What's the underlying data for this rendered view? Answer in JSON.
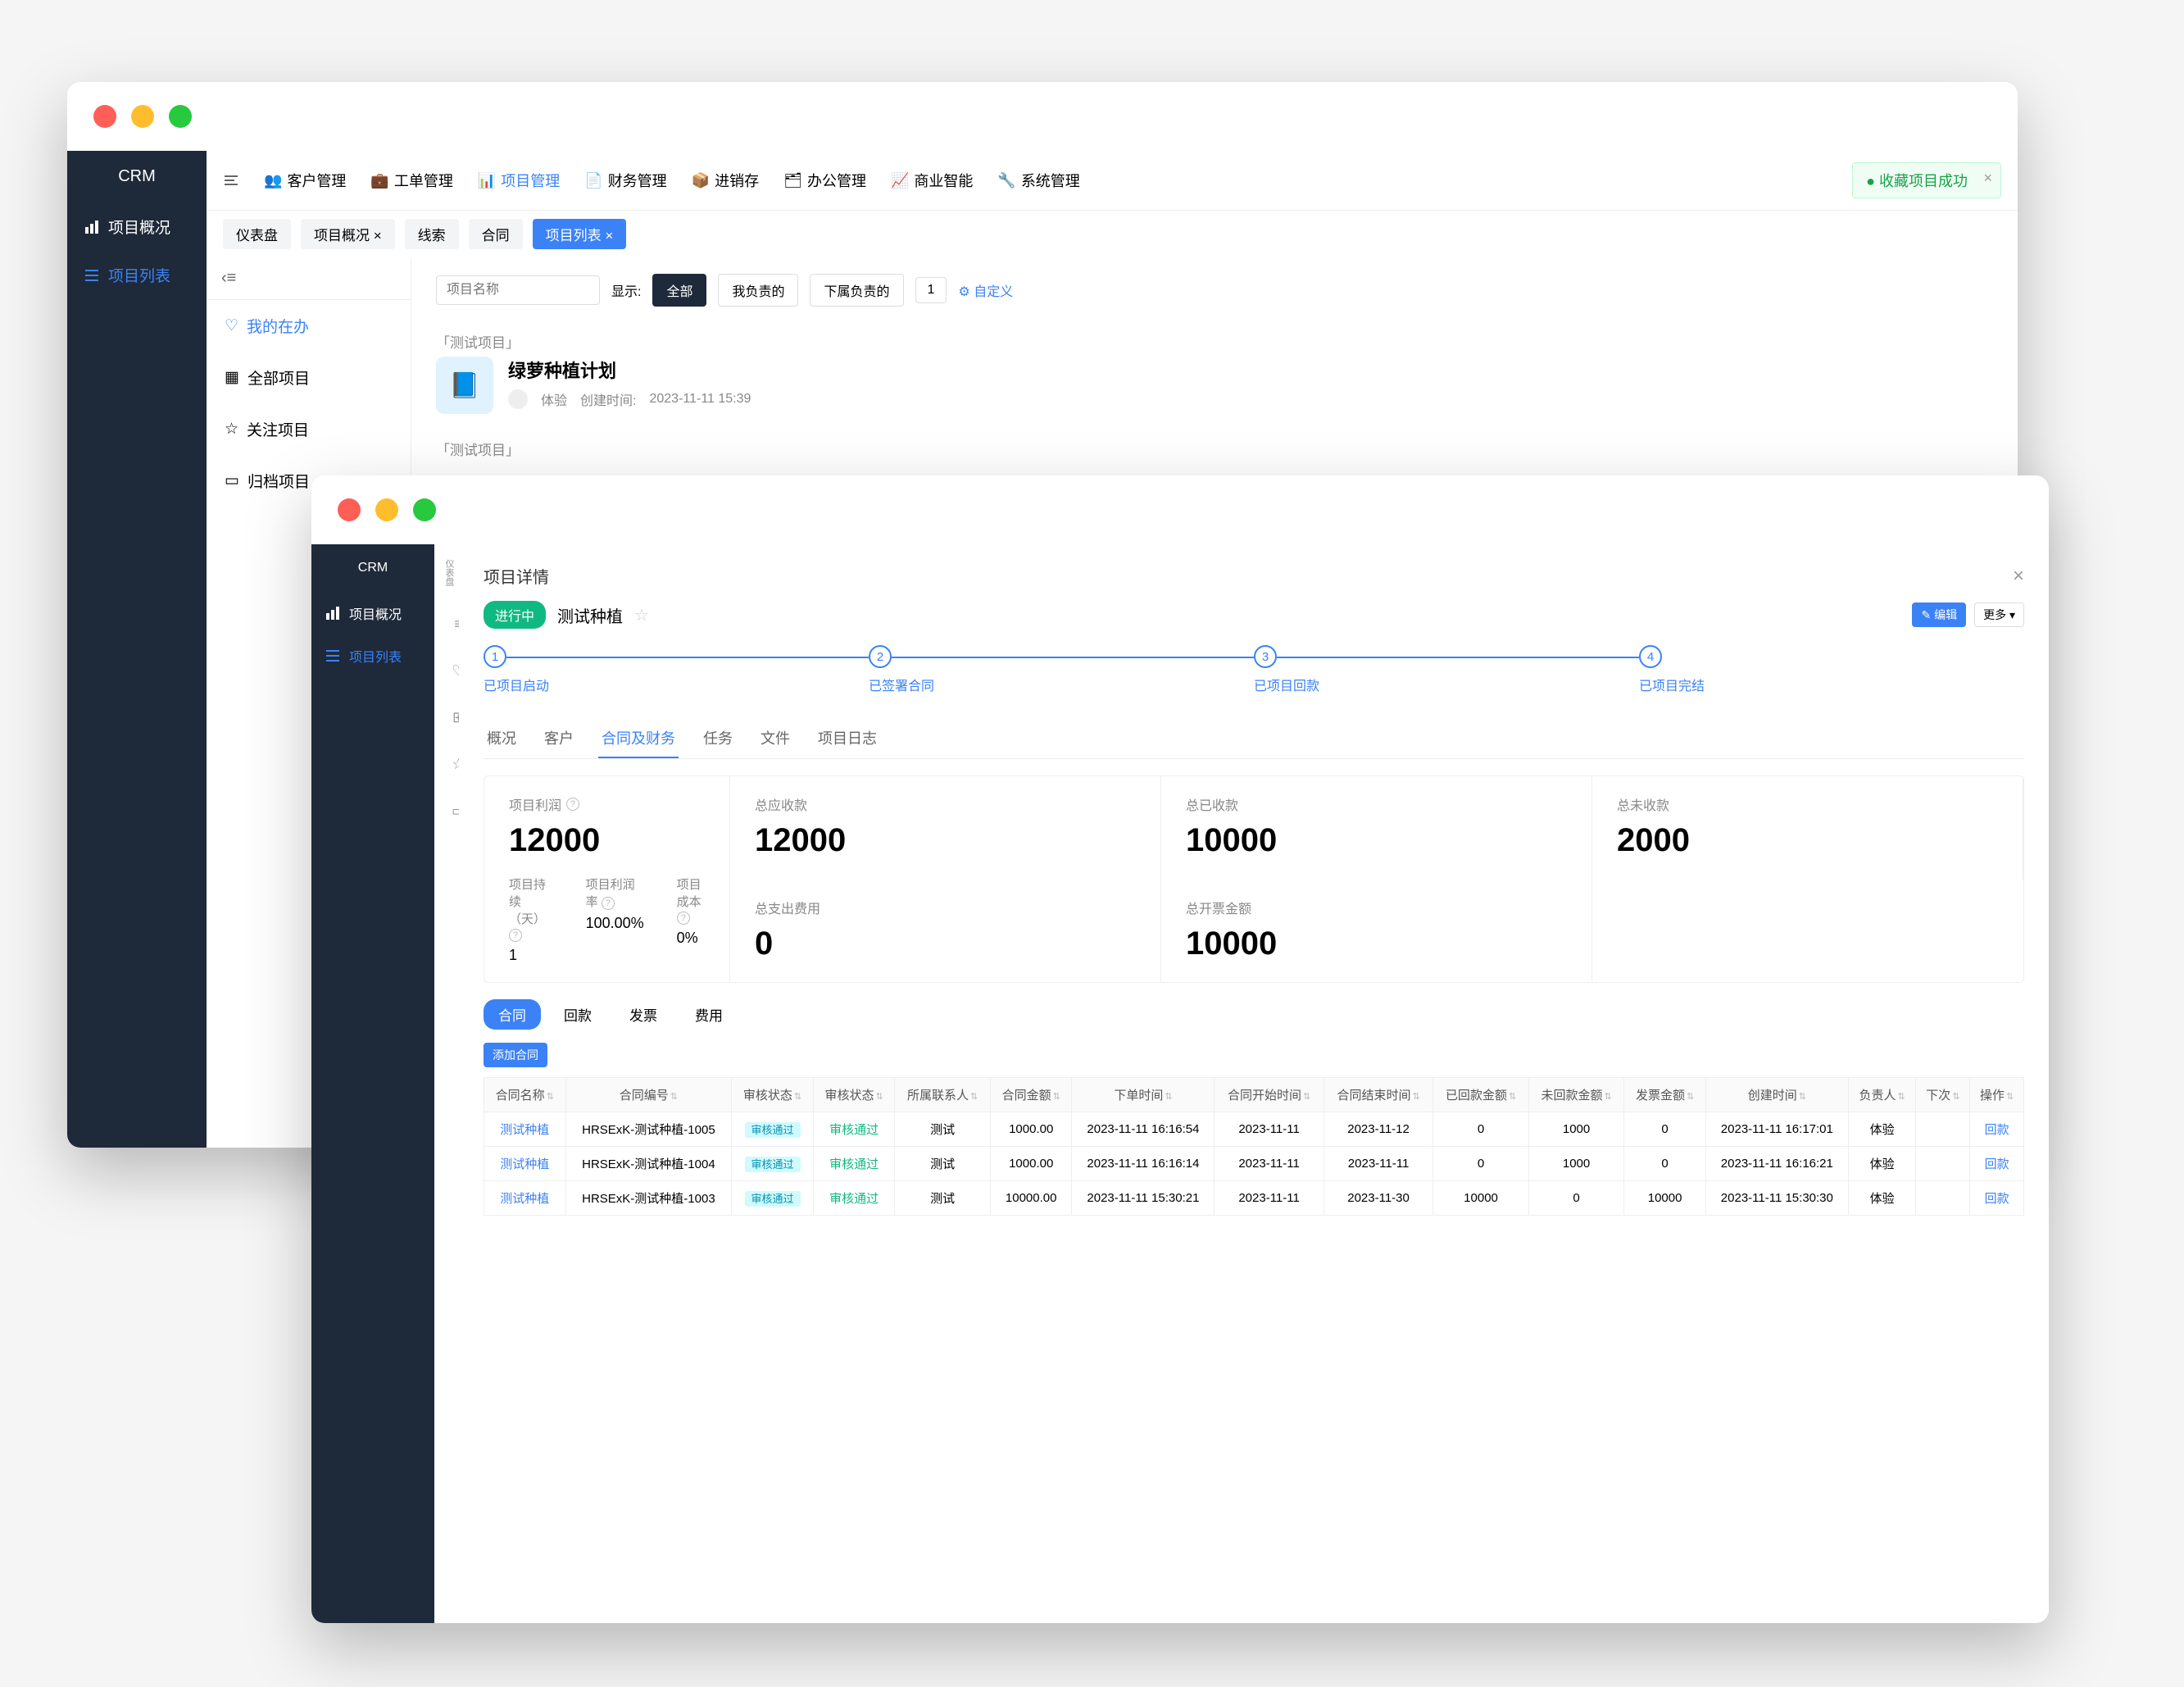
{
  "window1": {
    "sidebar": {
      "logo": "CRM",
      "items": [
        {
          "icon": "chart",
          "label": "项目概况"
        },
        {
          "icon": "list",
          "label": "项目列表"
        }
      ]
    },
    "topnav": [
      {
        "label": "客户管理"
      },
      {
        "label": "工单管理"
      },
      {
        "label": "项目管理",
        "active": true
      },
      {
        "label": "财务管理"
      },
      {
        "label": "进销存"
      },
      {
        "label": "办公管理"
      },
      {
        "label": "商业智能"
      },
      {
        "label": "系统管理"
      }
    ],
    "toast": {
      "text": "收藏项目成功",
      "icon": "✓"
    },
    "tabs": [
      {
        "label": "仪表盘"
      },
      {
        "label": "项目概况 ×"
      },
      {
        "label": "线索"
      },
      {
        "label": "合同"
      },
      {
        "label": "项目列表 ×",
        "active": true
      }
    ],
    "filter_hdr": "‹≡",
    "filters": [
      {
        "icon": "heart",
        "label": "我的在办",
        "active": true
      },
      {
        "icon": "grid",
        "label": "全部项目"
      },
      {
        "icon": "star",
        "label": "关注项目"
      },
      {
        "icon": "archive",
        "label": "归档项目"
      }
    ],
    "search": {
      "placeholder": "项目名称"
    },
    "display_label": "显示:",
    "display_buttons": [
      {
        "label": "全部",
        "primary": true
      },
      {
        "label": "我负责的"
      },
      {
        "label": "下属负责的"
      }
    ],
    "badge_count": "1",
    "custom_link": "⚙ 自定义",
    "projects": [
      {
        "tag": "「测试项目」",
        "title": "绿萝种植计划",
        "owner": "体验",
        "time_lbl": "创建时间:",
        "time": "2023-11-11 15:39"
      },
      {
        "tag": "「测试项目」"
      }
    ]
  },
  "window2": {
    "sidebar": {
      "logo": "CRM",
      "items": [
        {
          "icon": "chart",
          "label": "项目概况"
        },
        {
          "icon": "list",
          "label": "项目列表",
          "active": true
        }
      ]
    },
    "mini_tabs": [
      "仪表盘",
      "≡",
      "♡",
      "⊞",
      "☆",
      "▭"
    ],
    "detail": {
      "title": "项目详情",
      "status": "进行中",
      "name": "测试种植",
      "edit_btn": "✎ 编辑",
      "more_btn": "更多 ▾",
      "steps": [
        {
          "num": "1",
          "label": "已项目启动"
        },
        {
          "num": "2",
          "label": "已签署合同"
        },
        {
          "num": "3",
          "label": "已项目回款"
        },
        {
          "num": "4",
          "label": "已项目完结"
        }
      ],
      "dtabs": [
        "概况",
        "客户",
        "合同及财务",
        "任务",
        "文件",
        "项目日志"
      ],
      "dtab_active": 2,
      "stats_left": {
        "label": "项目利润",
        "value": "12000",
        "sub": [
          {
            "lbl": "项目持续（天）",
            "val": "1"
          },
          {
            "lbl": "项目利润率",
            "val": "100.00%"
          },
          {
            "lbl": "项目成本",
            "val": "0%"
          }
        ]
      },
      "stats_grid": [
        {
          "lbl": "总应收款",
          "val": "12000"
        },
        {
          "lbl": "总已收款",
          "val": "10000"
        },
        {
          "lbl": "总未收款",
          "val": "2000"
        },
        {
          "lbl": "总支出费用",
          "val": "0"
        },
        {
          "lbl": "总开票金额",
          "val": "10000"
        }
      ],
      "subtabs": [
        "合同",
        "回款",
        "发票",
        "费用"
      ],
      "subtab_active": 0,
      "add_btn": "添加合同",
      "columns": [
        "合同名称",
        "合同编号",
        "审核状态",
        "审核状态",
        "所属联系人",
        "合同金额",
        "下单时间",
        "合同开始时间",
        "合同结束时间",
        "已回款金额",
        "未回款金额",
        "发票金额",
        "创建时间",
        "负责人",
        "下次",
        "操作"
      ],
      "rows": [
        {
          "name": "测试种植",
          "code": "HRSExK-测试种植-1005",
          "tag": "审核通过",
          "status": "审核通过",
          "contact": "测试",
          "amount": "1000.00",
          "order": "2023-11-11 16:16:54",
          "start": "2023-11-11",
          "end": "2023-11-12",
          "paid": "0",
          "unpaid": "1000",
          "invoice": "0",
          "created": "2023-11-11 16:17:01",
          "owner": "体验",
          "next": "",
          "op": "回款"
        },
        {
          "name": "测试种植",
          "code": "HRSExK-测试种植-1004",
          "tag": "审核通过",
          "status": "审核通过",
          "contact": "测试",
          "amount": "1000.00",
          "order": "2023-11-11 16:16:14",
          "start": "2023-11-11",
          "end": "2023-11-11",
          "paid": "0",
          "unpaid": "1000",
          "invoice": "0",
          "created": "2023-11-11 16:16:21",
          "owner": "体验",
          "next": "",
          "op": "回款"
        },
        {
          "name": "测试种植",
          "code": "HRSExK-测试种植-1003",
          "tag": "审核通过",
          "status": "审核通过",
          "contact": "测试",
          "amount": "10000.00",
          "order": "2023-11-11 15:30:21",
          "start": "2023-11-11",
          "end": "2023-11-30",
          "paid": "10000",
          "unpaid": "0",
          "invoice": "10000",
          "created": "2023-11-11 15:30:30",
          "owner": "体验",
          "next": "",
          "op": "回款"
        }
      ]
    }
  }
}
